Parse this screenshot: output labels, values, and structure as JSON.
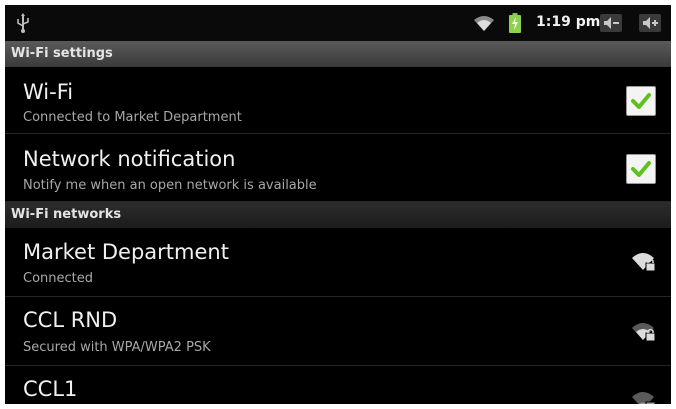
{
  "status_bar": {
    "time": "1:19 pm",
    "icons": [
      "usb-icon",
      "wifi-signal-icon",
      "battery-charging-icon",
      "volume-down-icon",
      "volume-up-icon"
    ]
  },
  "sections": {
    "settings_header": "Wi-Fi settings",
    "networks_header": "Wi-Fi networks"
  },
  "settings": {
    "wifi": {
      "title": "Wi-Fi",
      "summary": "Connected to Market Department",
      "checked": true
    },
    "notification": {
      "title": "Network notification",
      "summary": "Notify me when an open network is available",
      "checked": true
    }
  },
  "networks": [
    {
      "name": "Market Department",
      "status": "Connected",
      "icon": "wifi-secured-icon"
    },
    {
      "name": "CCL RND",
      "status": "Secured with WPA/WPA2 PSK",
      "icon": "wifi-secured-icon"
    },
    {
      "name": "CCL1",
      "status": "",
      "icon": "wifi-secured-icon"
    }
  ],
  "colors": {
    "check": "#5ec21c",
    "background": "#000000",
    "header": "#4a4a4a"
  }
}
